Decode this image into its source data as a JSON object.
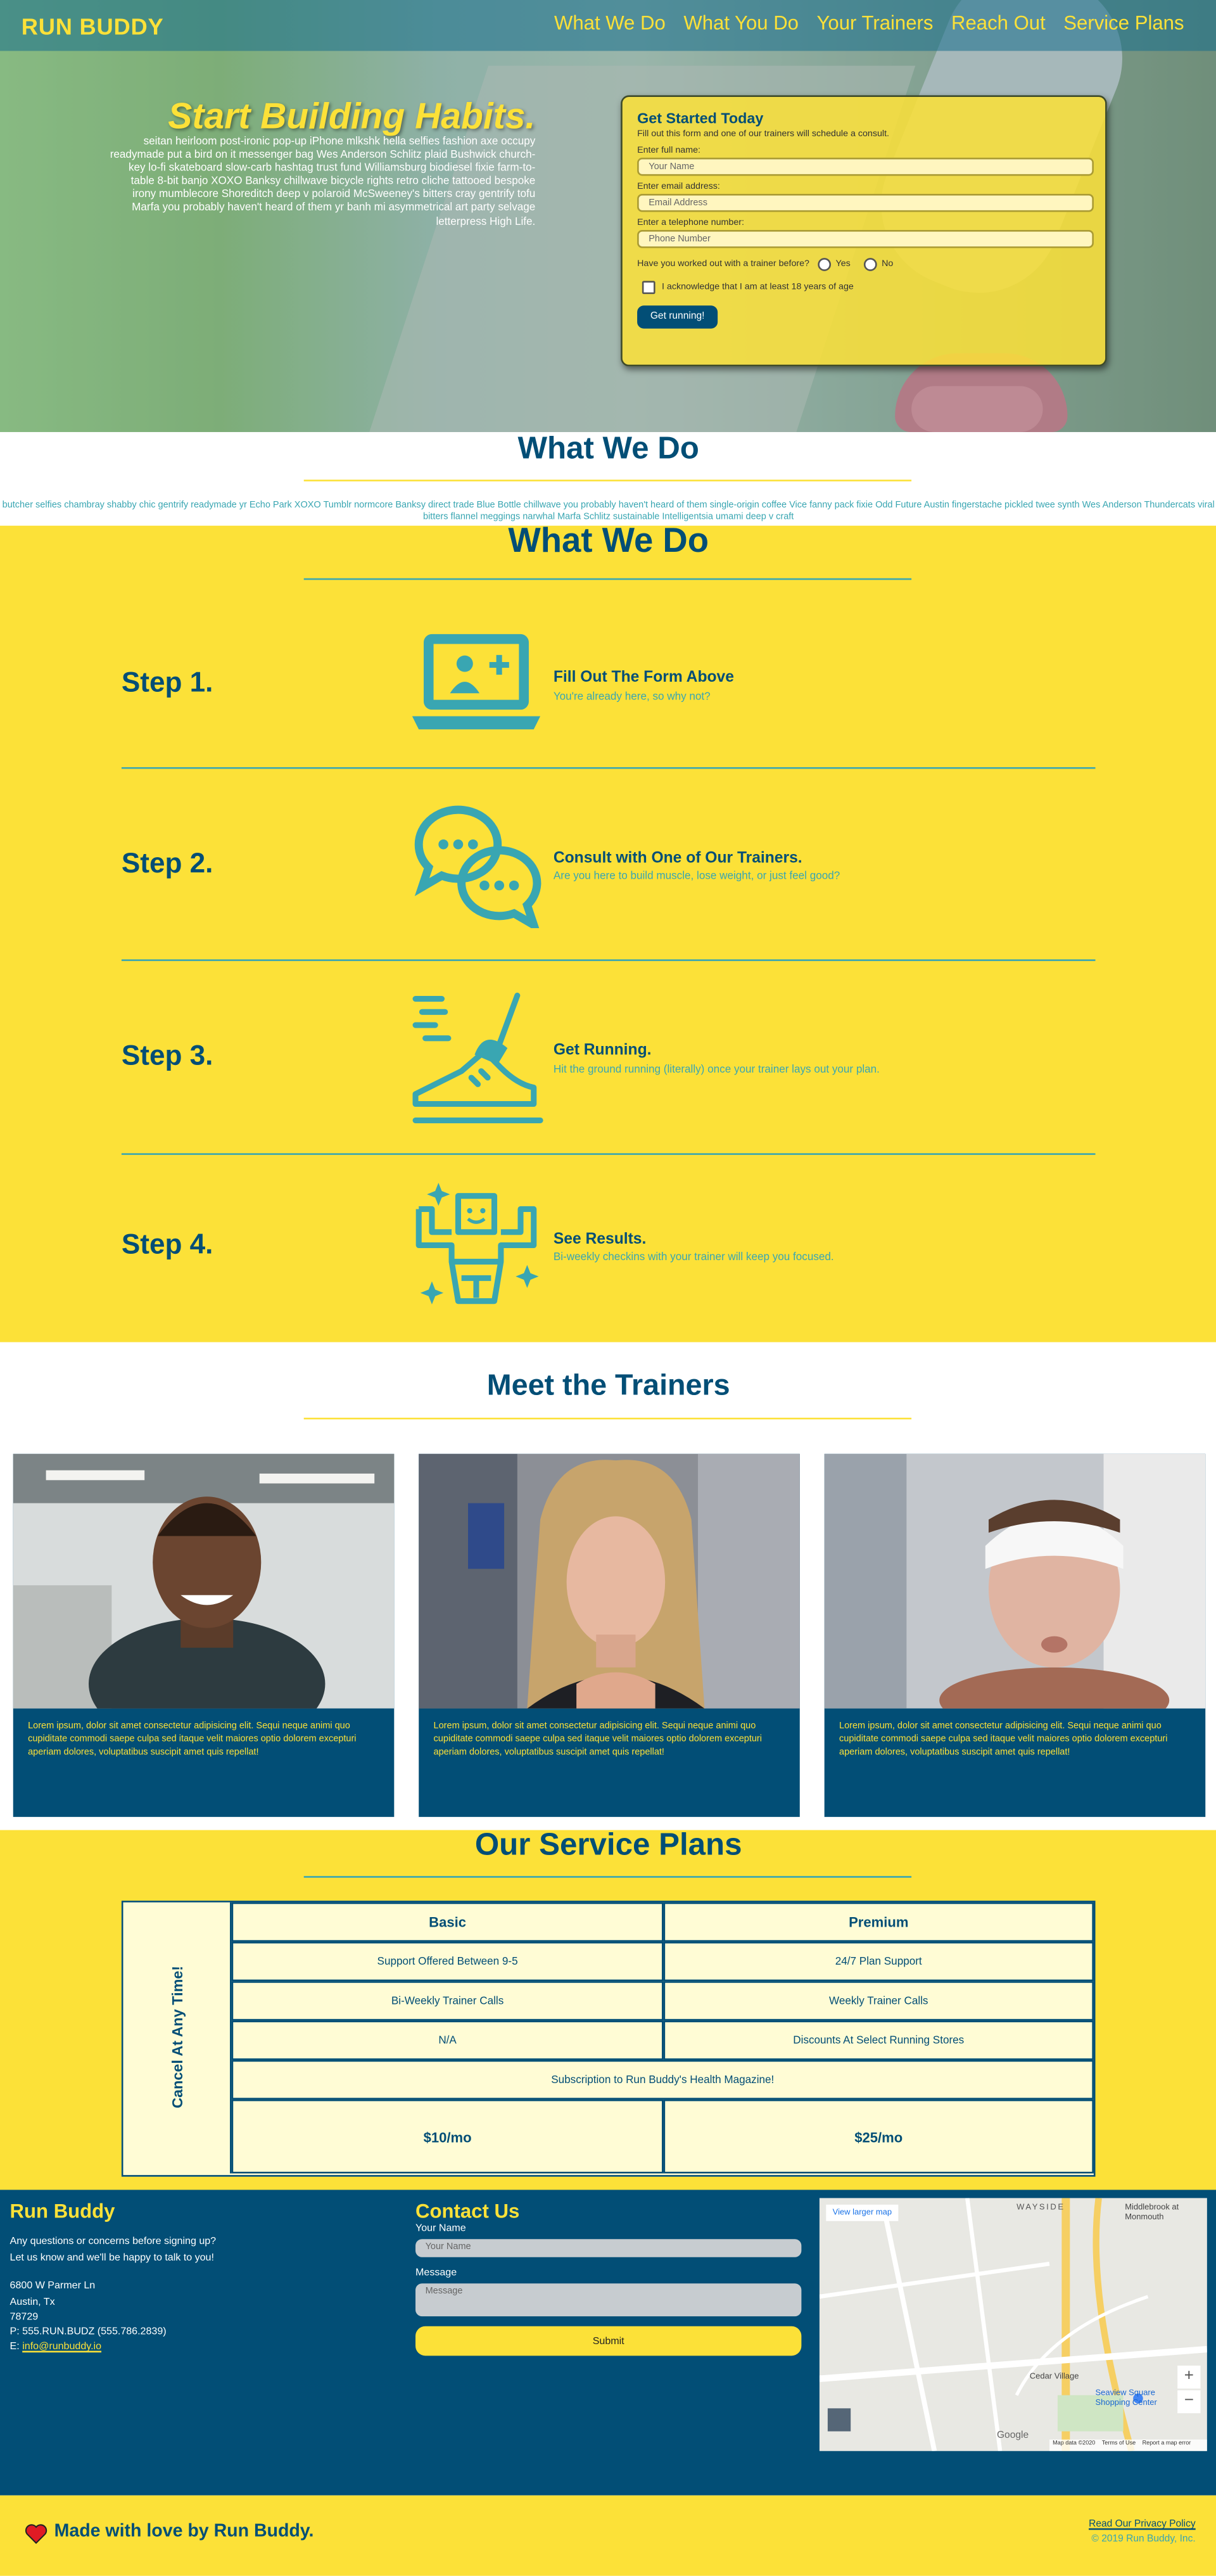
{
  "header": {
    "logo": "RUN BUDDY",
    "nav": [
      "What We Do",
      "What You Do",
      "Your Trainers",
      "Reach Out",
      "Service Plans"
    ]
  },
  "hero": {
    "title": "Start Building Habits.",
    "text": "seitan heirloom post-ironic pop-up iPhone mlkshk hella selfies fashion axe occupy readymade put a bird on it messenger bag Wes Anderson Schlitz plaid Bushwick church-key lo-fi skateboard slow-carb hashtag trust fund Williamsburg biodiesel fixie farm-to-table 8-bit banjo XOXO Banksy chillwave bicycle rights retro cliche tattooed bespoke irony mumblecore Shoreditch deep v polaroid McSweeney's bitters cray gentrify tofu Marfa you probably haven't heard of them yr banh mi asymmetrical art party selvage letterpress High Life."
  },
  "form": {
    "title": "Get Started Today",
    "subtitle": "Fill out this form and one of our trainers will schedule a consult.",
    "name_label": "Enter full name:",
    "name_placeholder": "Your Name",
    "email_label": "Enter email address:",
    "email_placeholder": "Email Address",
    "phone_label": "Enter a telephone number:",
    "phone_placeholder": "Phone Number",
    "radio_question": "Have you worked out with a trainer before?",
    "yes": "Yes",
    "no": "No",
    "checkbox_label": "I acknowledge that I am at least 18 years of age",
    "button": "Get running!"
  },
  "what_we_do": {
    "title": "What We Do",
    "text": "butcher selfies chambray shabby chic gentrify readymade yr Echo Park XOXO Tumblr normcore Banksy direct trade Blue Bottle chillwave you probably haven't heard of them single-origin coffee Vice fanny pack fixie Odd Future Austin fingerstache pickled twee synth Wes Anderson Thundercats viral bitters flannel meggings narwhal Marfa Schlitz sustainable Intelligentsia umami deep v craft"
  },
  "steps": {
    "title": "What We Do",
    "items": [
      {
        "num": "Step 1.",
        "head": "Fill Out The Form Above",
        "sub": "You're already here, so why not?",
        "icon": "laptop-user-icon"
      },
      {
        "num": "Step 2.",
        "head": "Consult with One of Our Trainers.",
        "sub": "Are you here to build muscle, lose weight, or just feel good?",
        "icon": "chat-bubbles-icon"
      },
      {
        "num": "Step 3.",
        "head": "Get Running.",
        "sub": "Hit the ground running (literally) once your trainer lays out your plan.",
        "icon": "running-shoe-icon"
      },
      {
        "num": "Step 4.",
        "head": "See Results.",
        "sub": "Bi-weekly checkins with your trainer will keep you focused.",
        "icon": "strong-person-icon"
      }
    ]
  },
  "trainers": {
    "title": "Meet the Trainers",
    "bio": "Lorem ipsum, dolor sit amet consectetur adipisicing elit. Sequi neque animi quo cupiditate commodi saepe culpa sed itaque velit maiores optio dolorem excepturi aperiam dolores, voluptatibus suscipit amet quis repellat!"
  },
  "plans": {
    "title": "Our Service Plans",
    "side": "Cancel At Any Time!",
    "basic": "Basic",
    "premium": "Premium",
    "rows": [
      [
        "Support Offered Between 9-5",
        "24/7 Plan Support"
      ],
      [
        "Bi-Weekly Trainer Calls",
        "Weekly Trainer Calls"
      ],
      [
        "N/A",
        "Discounts At Select Running Stores"
      ]
    ],
    "magazine": "Subscription to Run Buddy's Health Magazine!",
    "basic_price": "$10/mo",
    "premium_price": "$25/mo"
  },
  "footer": {
    "brand": "Run Buddy",
    "blurb1": "Any questions or concerns before signing up?",
    "blurb2": "Let us know and we'll be happy to talk to you!",
    "addr1": "6800 W Parmer Ln",
    "addr2": "Austin, Tx",
    "addr3": "78729",
    "phone": "P: 555.RUN.BUDZ (555.786.2839)",
    "email_prefix": "E: ",
    "email": "info@runbuddy.io",
    "contact_title": "Contact Us",
    "name_label": "Your Name",
    "name_placeholder": "Your Name",
    "message_label": "Message",
    "message_placeholder": "Message",
    "submit": "Submit",
    "map": {
      "view_larger": "View larger map",
      "wayside": "WAYSIDE",
      "middlebrook": "Middlebrook at Monmouth",
      "cedar": "Cedar Village",
      "seaview": "Seaview Square Shopping Center",
      "google": "Google",
      "map_data": "Map data ©2020",
      "terms": "Terms of Use",
      "report": "Report a map error"
    }
  },
  "bottom": {
    "made_with": "Made with love by Run Buddy.",
    "privacy": "Read Our Privacy Policy",
    "copyright": "© 2019 Run Buddy, Inc."
  }
}
